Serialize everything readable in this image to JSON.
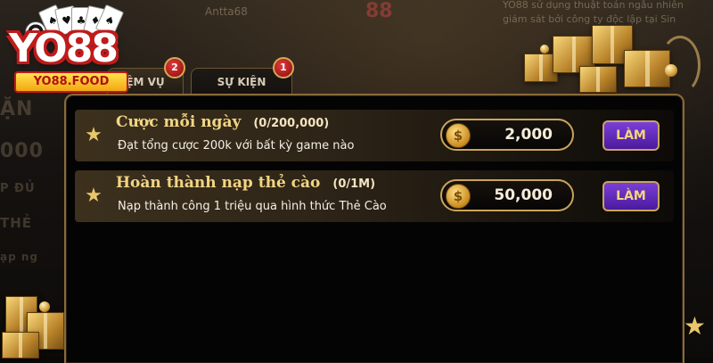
{
  "background": {
    "top_left_text": "Antta68",
    "top_mid_text": "88",
    "top_right_text": "YO88 sử dụng thuật toán ngẫu nhiên giám sát bởi công ty độc lập tại Sin",
    "left_fragments": [
      "ẶN",
      "000",
      "P ĐỦ",
      "THẺ",
      "ạp ng"
    ]
  },
  "logo": {
    "brand": "YO88",
    "domain": "YO88.FOOD"
  },
  "tabs": [
    {
      "label": "ỆM VỤ",
      "badge": "2"
    },
    {
      "label": "SỰ KIỆN",
      "badge": "1"
    }
  ],
  "tasks": [
    {
      "title": "Cược mỗi ngày",
      "progress": "(0/200,000)",
      "description": "Đạt tổng cược 200k với bất kỳ game nào",
      "reward": "2,000",
      "button": "LÀM"
    },
    {
      "title": "Hoàn thành nạp thẻ cào",
      "progress": "(0/1M)",
      "description": "Nạp thành công 1 triệu qua hình thức Thẻ Cào",
      "reward": "50,000",
      "button": "LÀM"
    }
  ],
  "icons": {
    "star": "star-icon",
    "coin": "coin-icon"
  },
  "colors": {
    "gold": "#e9c66a",
    "button_purple": "#5b25b5",
    "panel_border": "#8a6a3a"
  }
}
